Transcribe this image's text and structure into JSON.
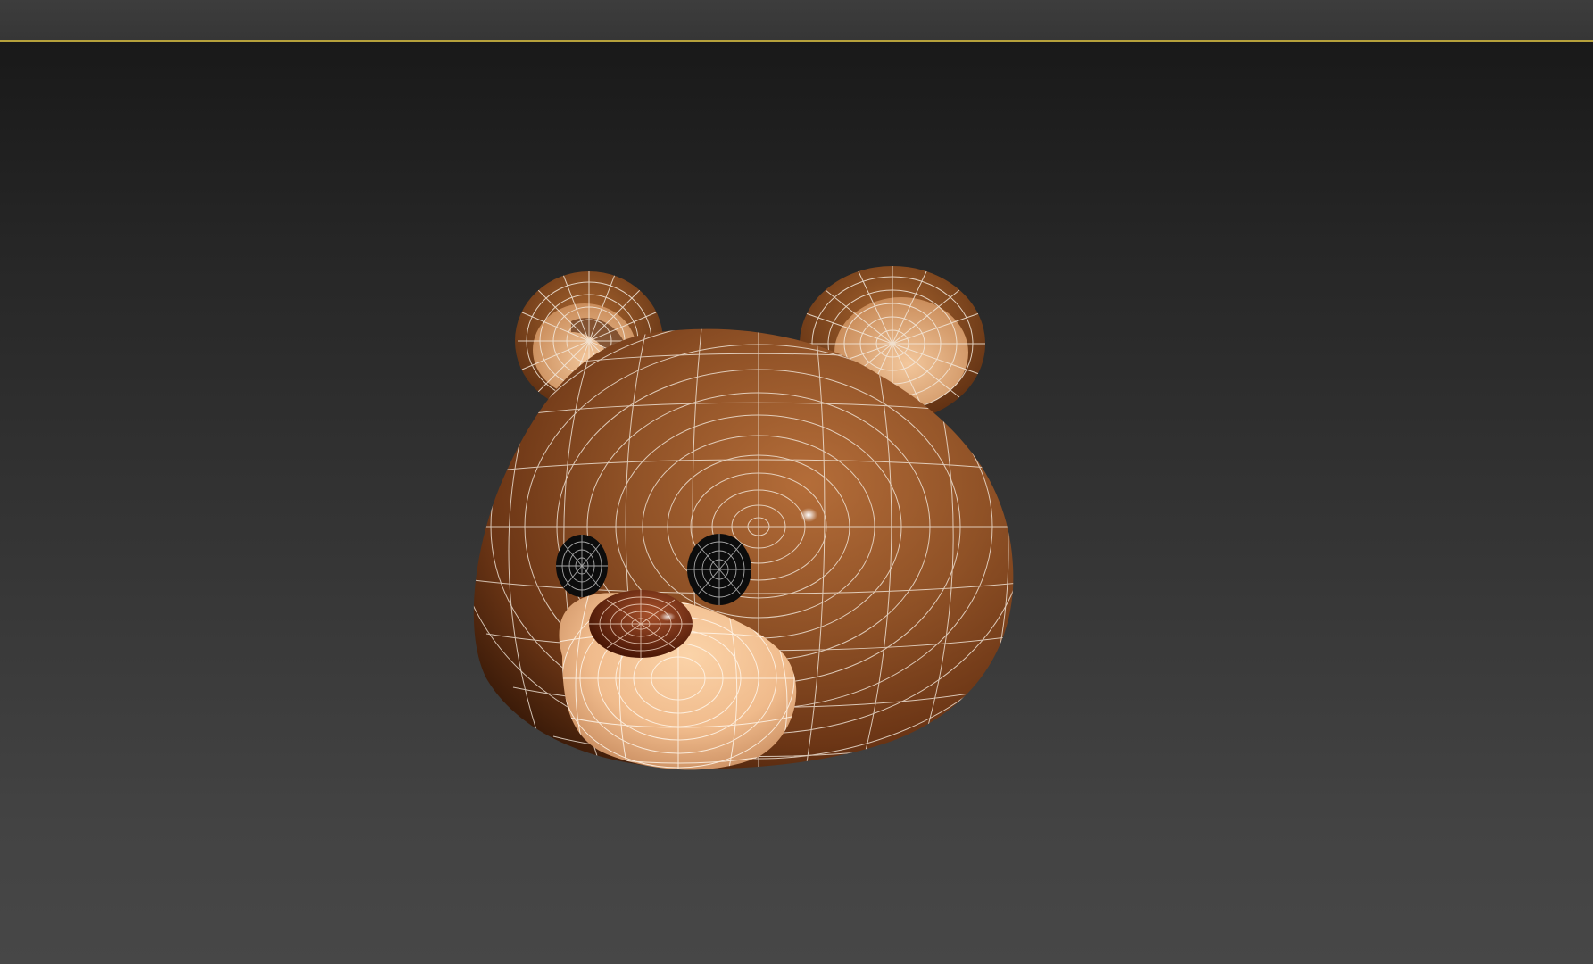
{
  "viewport": {
    "object_icon": "bear-head-model-icon",
    "colors": {
      "fur": "#8a4d24",
      "fur_light": "#b06a38",
      "fur_dark": "#3f1e0b",
      "muzzle": "#f2c194",
      "inner_ear": "#e9b487",
      "nose": "#5e220c",
      "eye": "#0c0c0c",
      "wire": "#f4e9dc",
      "selection_border": "#b6a13c"
    }
  }
}
